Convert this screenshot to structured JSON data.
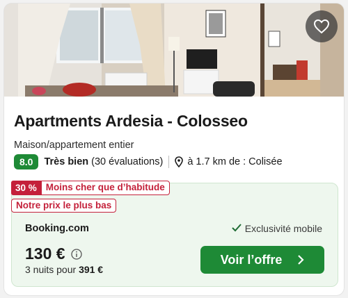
{
  "hotel": {
    "name": "Apartments Ardesia - Colosseo",
    "type": "Maison/appartement entier",
    "rating_score": "8.0",
    "rating_word": "Très bien",
    "reviews": "(30 évaluations)",
    "distance": "à 1.7 km de : Colisée"
  },
  "deal": {
    "discount_pct": "30 %",
    "discount_text": "Moins cher que d’habitude",
    "lowest_price": "Notre prix le plus bas",
    "provider": "Booking.com",
    "exclusive": "Exclusivité mobile",
    "price": "130 €",
    "nights_prefix": "3 nuits pour",
    "total": "391 €",
    "cta": "Voir l’offre"
  },
  "colors": {
    "green": "#1e8a36",
    "red": "#c4203a",
    "deal_bg": "#eef7ee"
  },
  "icons": [
    "heart-icon",
    "map-pin-icon",
    "check-icon",
    "info-icon",
    "chevron-right-icon"
  ]
}
